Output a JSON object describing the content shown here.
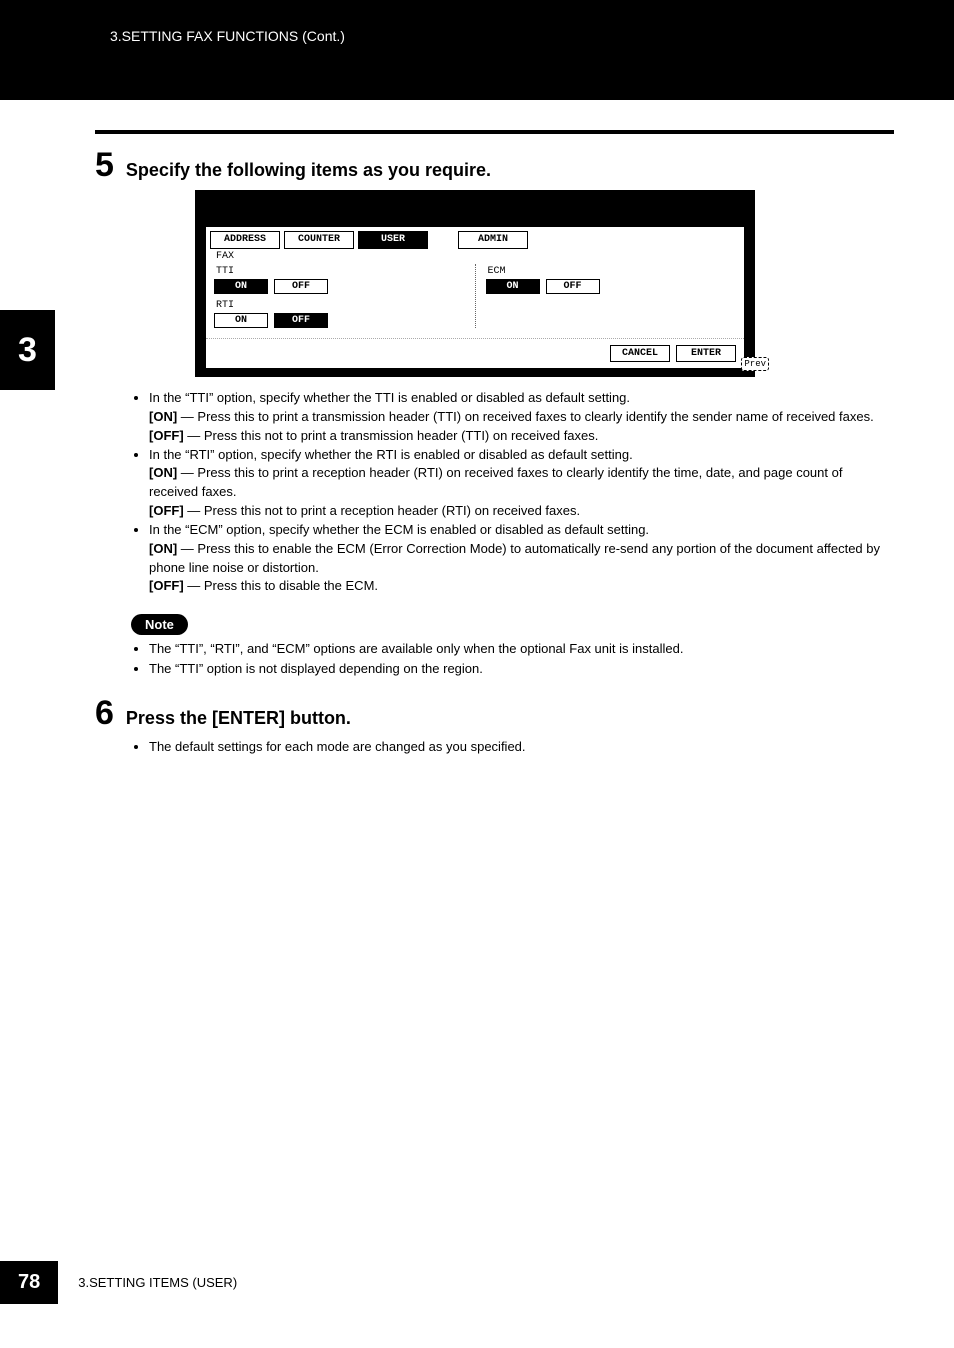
{
  "header": {
    "breadcrumb": "3.SETTING FAX FUNCTIONS (Cont.)"
  },
  "side_tab": "3",
  "steps": {
    "s5": {
      "num": "5",
      "title": "Specify the following items as you require."
    },
    "s6": {
      "num": "6",
      "title": "Press the [ENTER] button."
    }
  },
  "screen": {
    "tabs": {
      "address": "ADDRESS",
      "counter": "COUNTER",
      "user": "USER",
      "admin": "ADMIN"
    },
    "sub": "FAX",
    "tti": {
      "label": "TTI",
      "on": "ON",
      "off": "OFF"
    },
    "rti": {
      "label": "RTI",
      "on": "ON",
      "off": "OFF"
    },
    "ecm": {
      "label": "ECM",
      "on": "ON",
      "off": "OFF"
    },
    "actions": {
      "cancel": "CANCEL",
      "enter": "ENTER",
      "prev": "Prev"
    }
  },
  "body": {
    "tti_intro": "In the “TTI” option, specify whether the TTI is enabled or disabled as default setting.",
    "tti_on_label": "[ON]",
    "tti_on": " — Press this to print a transmission header (TTI) on received faxes to clearly identify the sender name of received faxes.",
    "tti_off_label": "[OFF]",
    "tti_off": " — Press this not to print a transmission header (TTI) on received faxes.",
    "rti_intro": "In the “RTI” option, specify whether the RTI is enabled or disabled as default setting.",
    "rti_on_label": "[ON]",
    "rti_on": " — Press this to print a reception header (RTI) on received faxes to clearly identify the time, date, and page count of received faxes.",
    "rti_off_label": "[OFF]",
    "rti_off": " — Press this not to print a reception header (RTI) on received faxes.",
    "ecm_intro": "In the “ECM” option, specify whether the ECM is enabled or disabled as default setting.",
    "ecm_on_label": "[ON]",
    "ecm_on": " — Press this to enable the ECM (Error Correction Mode) to automatically re-send any portion of the document affected by phone line noise or distortion.",
    "ecm_off_label": "[OFF]",
    "ecm_off": " — Press this to disable the ECM."
  },
  "note": {
    "label": "Note",
    "n1": "The “TTI”, “RTI”, and “ECM” options are available only when the optional Fax unit is installed.",
    "n2": "The “TTI” option is not displayed depending on the region."
  },
  "step6_body": "The default settings for each mode are changed as you specified.",
  "footer": {
    "page": "78",
    "text": "3.SETTING ITEMS (USER)"
  }
}
